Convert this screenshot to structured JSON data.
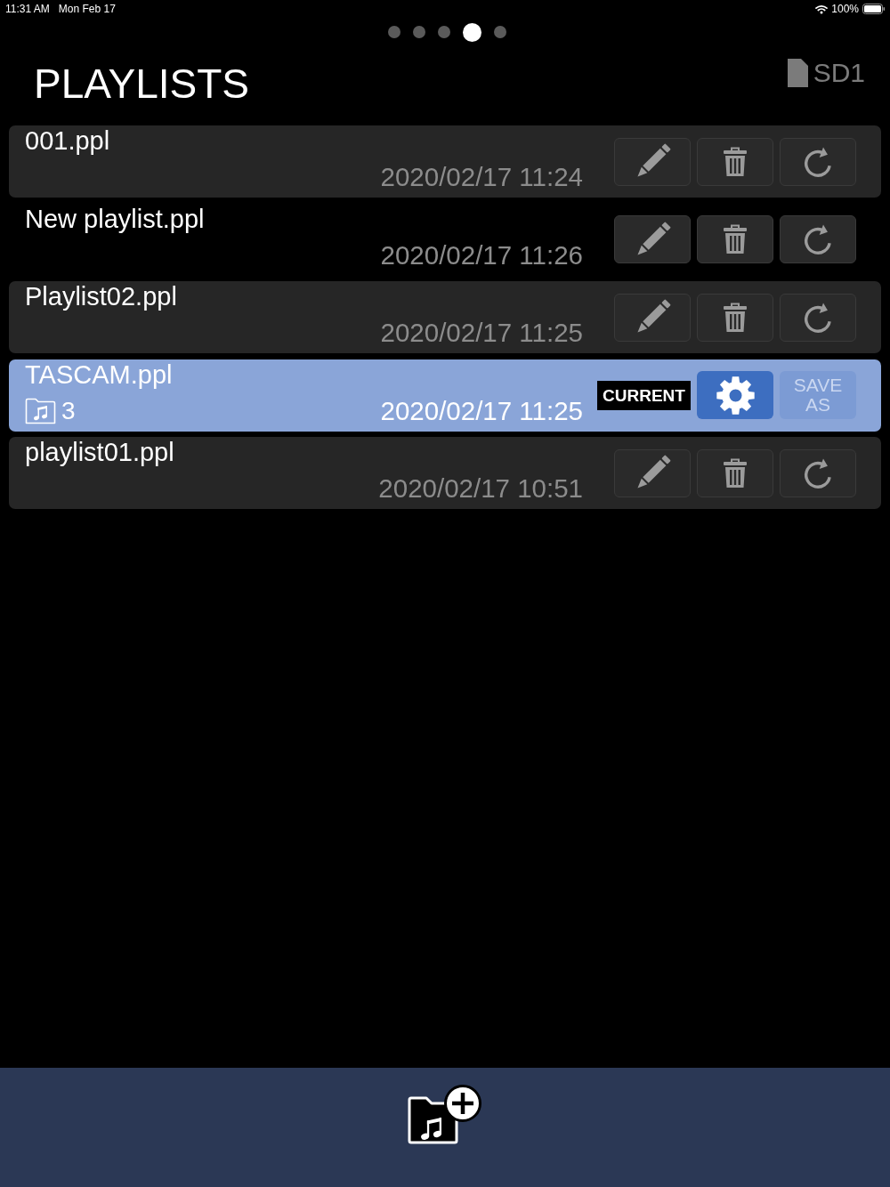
{
  "status_bar": {
    "time": "11:31 AM",
    "date": "Mon Feb 17",
    "battery": "100%"
  },
  "pager": [
    {
      "selected": false
    },
    {
      "selected": false
    },
    {
      "selected": false
    },
    {
      "selected": true
    },
    {
      "selected": false
    }
  ],
  "header": {
    "title": "PLAYLISTS",
    "storage": "SD1"
  },
  "playlists": [
    {
      "name": "001.ppl",
      "date": "2020/02/17 11:24",
      "current": false
    },
    {
      "name": "New playlist.ppl",
      "date": "2020/02/17 11:26",
      "current": false
    },
    {
      "name": "Playlist02.ppl",
      "date": "2020/02/17 11:25",
      "current": false
    },
    {
      "name": "TASCAM.ppl",
      "date": "2020/02/17 11:25",
      "current": true,
      "current_label": "CURRENT",
      "count": "3",
      "save_as": "SAVE AS"
    },
    {
      "name": "playlist01.ppl",
      "date": "2020/02/17 10:51",
      "current": false
    }
  ]
}
